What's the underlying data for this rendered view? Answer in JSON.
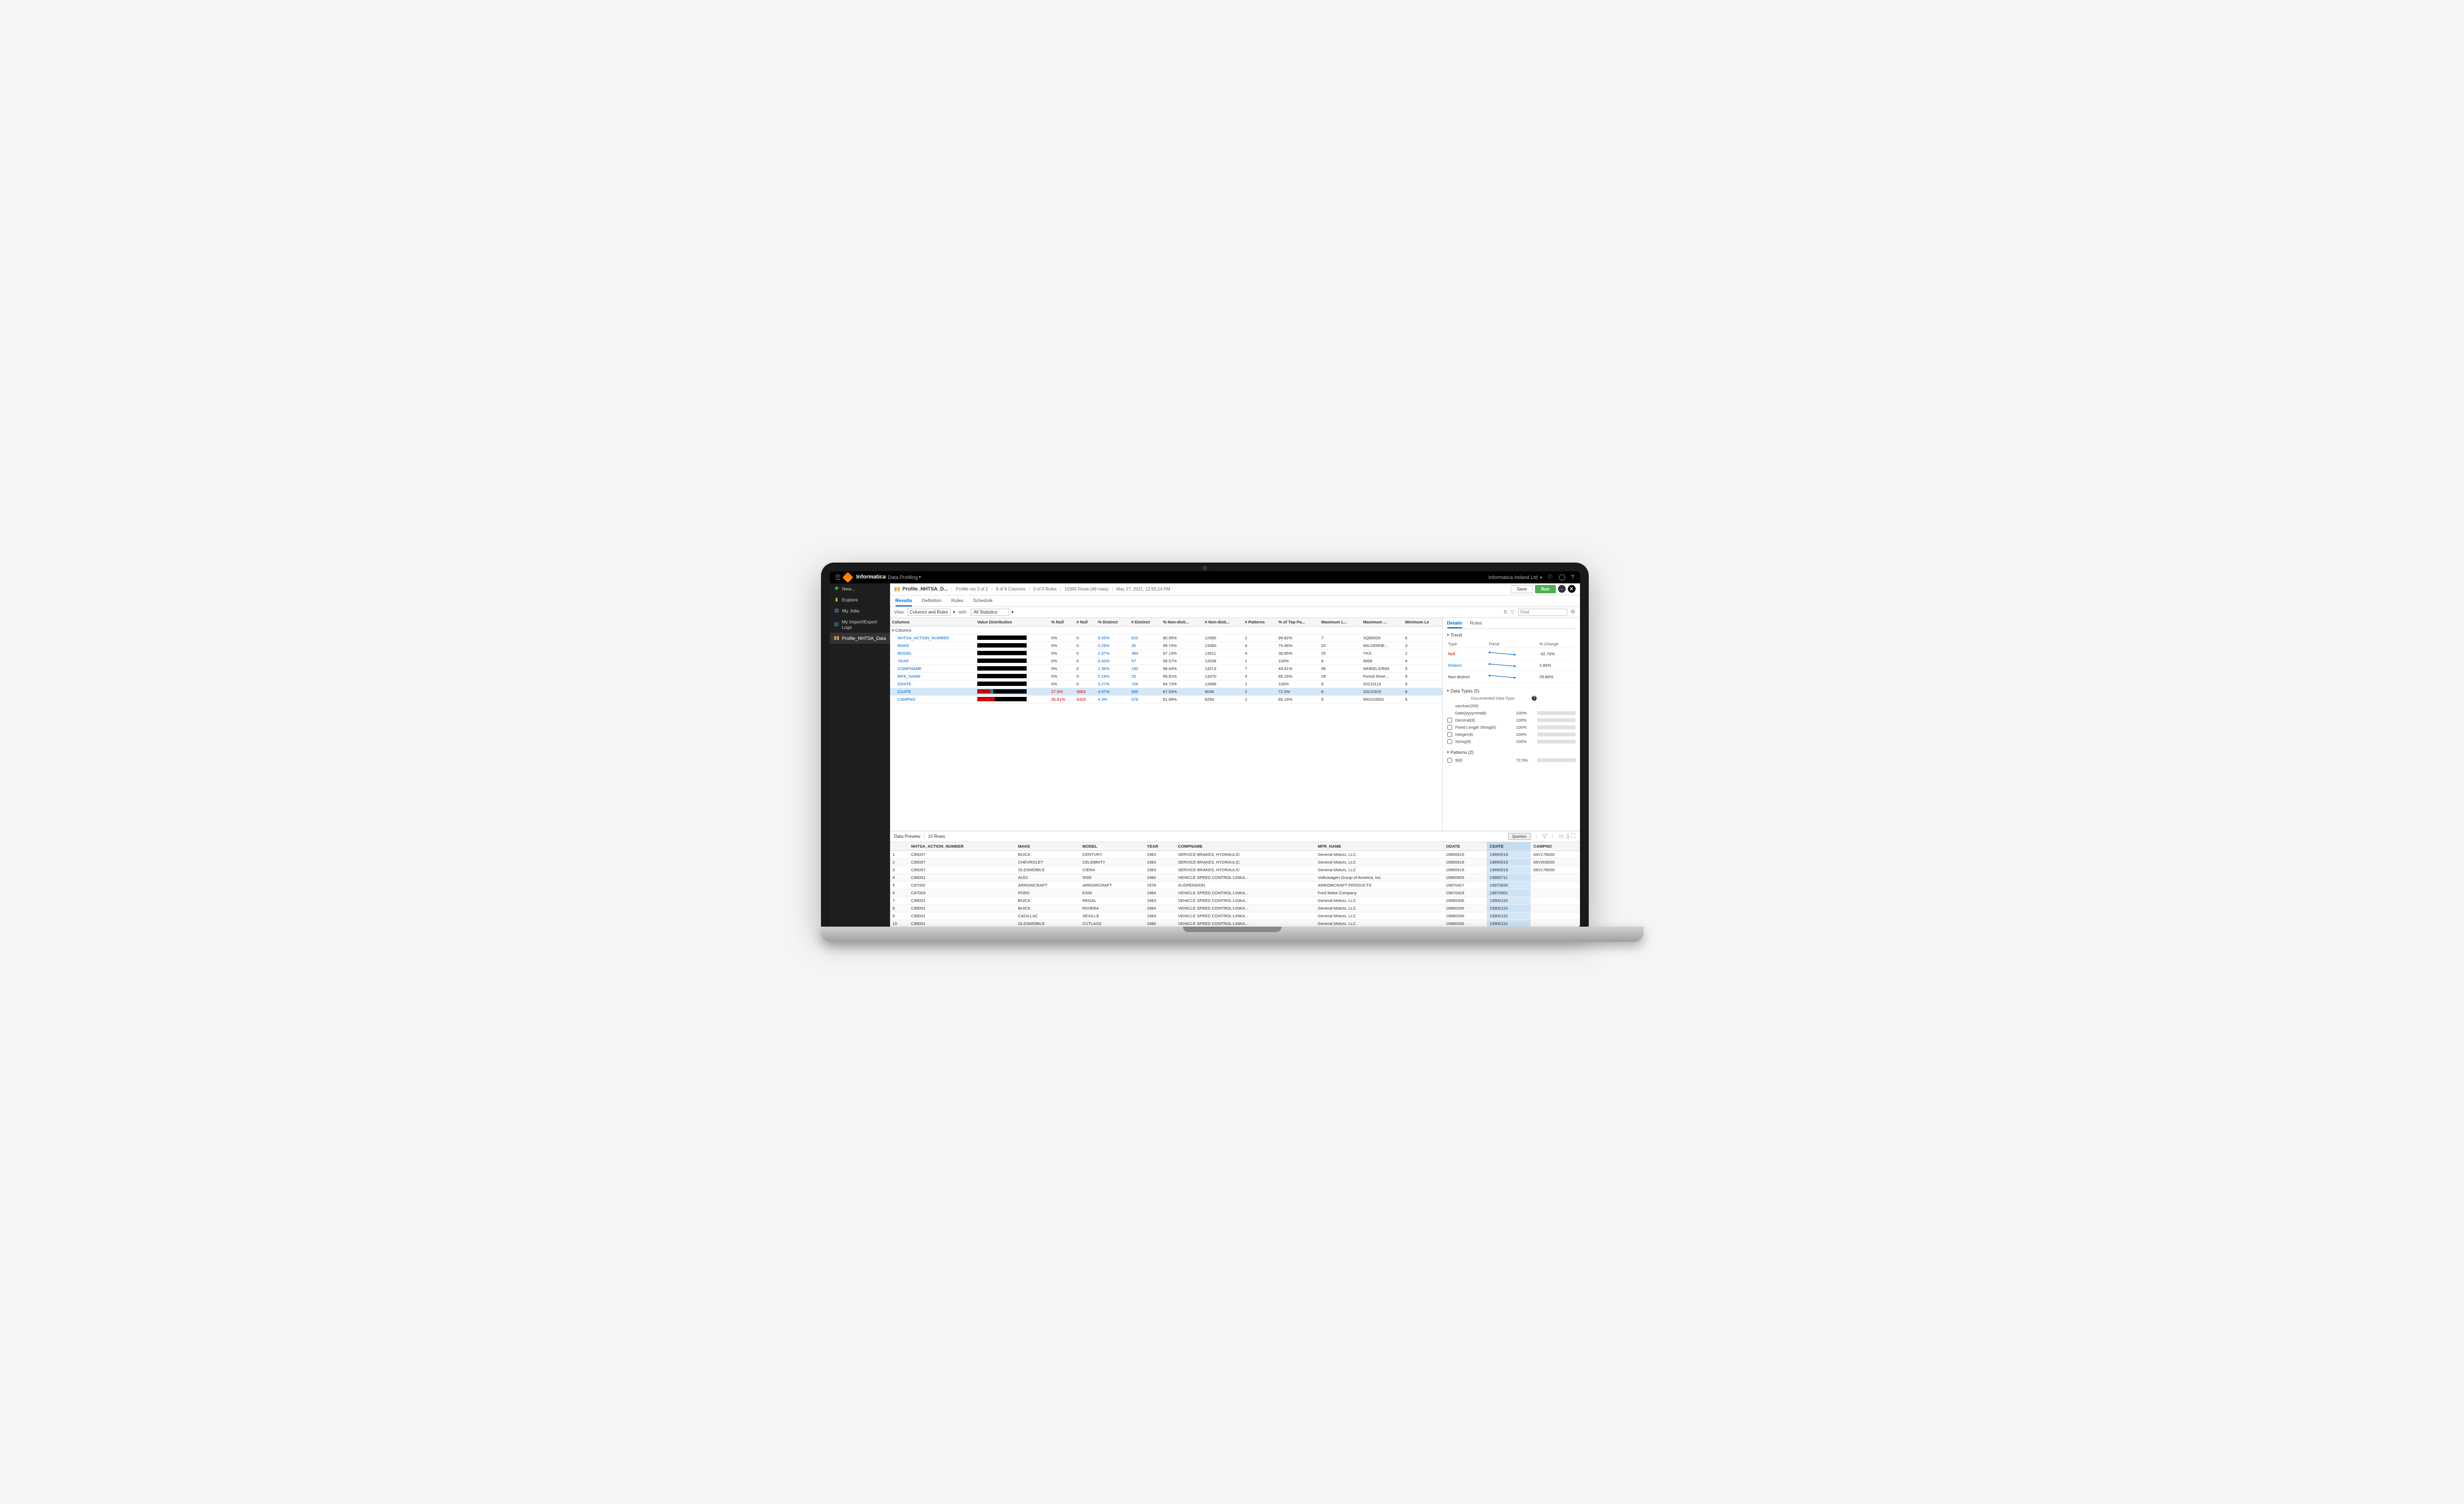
{
  "topbar": {
    "brand": "Informatica",
    "module": "Data Profiling",
    "org": "Informatica Ireland Ltd"
  },
  "sidebar": {
    "items": [
      {
        "icon": "ic-new",
        "label": "New..."
      },
      {
        "icon": "ic-explore",
        "label": "Explore"
      },
      {
        "icon": "ic-jobs",
        "label": "My Jobs"
      },
      {
        "icon": "ic-log",
        "label": "My Import/Export Logs"
      },
      {
        "icon": "ic-profile",
        "label": "Profile_NHTSA_Data",
        "active": true,
        "closable": true
      }
    ]
  },
  "tabheader": {
    "title": "Profile_NHTSA_D...",
    "info": [
      "Profile run 2 of 2",
      "9 of 9 Columns",
      "0 of 0 Rules",
      "10395 Rows (All rows)",
      "May 27, 2021, 12:55:14 PM"
    ],
    "save": "Save",
    "run": "Run"
  },
  "subtabs": [
    "Results",
    "Definition",
    "Rules",
    "Schedule"
  ],
  "viewbar": {
    "label": "View:",
    "select1": "Columns and Rules",
    "with": "with:",
    "select2": "All Statistics",
    "find": "Find"
  },
  "grid": {
    "headers": [
      "Columns",
      "Value Distribution",
      "% Null",
      "# Null",
      "% Distinct",
      "# Distinct",
      "% Non-disti...",
      "# Non-disti...",
      "# Patterns",
      "% of Top Pa...",
      "Maximum L...",
      "Maximum ...",
      "Minimum Le"
    ],
    "section": "Columns",
    "rows": [
      {
        "name": "NHTSA_ACTION_NUMBER",
        "d": {
          "r": 0,
          "t": 0
        },
        "pn": "0%",
        "nn": "0",
        "pd": "6.05%",
        "nd": "610",
        "pnd": "90.95%",
        "nnd": "12585",
        "pt": "2",
        "ptp": "99.82%",
        "ml": "7",
        "mx": "SQ99026",
        "mn": "6"
      },
      {
        "name": "MAKE",
        "d": {
          "r": 0,
          "t": 0
        },
        "pn": "0%",
        "nn": "0",
        "pd": "0.26%",
        "nd": "35",
        "pnd": "99.74%",
        "nnd": "13360",
        "pt": "4",
        "ptp": "75.46%",
        "ml": "20",
        "mx": "WILDERNE...",
        "mn": "3"
      },
      {
        "name": "MODEL",
        "d": {
          "r": 0,
          "t": 0
        },
        "pn": "0%",
        "nn": "0",
        "pd": "2.87%",
        "nd": "384",
        "pnd": "97.13%",
        "nnd": "13011",
        "pt": "4",
        "ptp": "36.85%",
        "ml": "25",
        "mx": "YKS",
        "mn": "2"
      },
      {
        "name": "YEAR",
        "d": {
          "r": 0,
          "t": 0
        },
        "pn": "0%",
        "nn": "0",
        "pd": "0.43%",
        "nd": "57",
        "pnd": "99.57%",
        "nnd": "13338",
        "pt": "1",
        "ptp": "100%",
        "ml": "4",
        "mx": "9999",
        "mn": "4"
      },
      {
        "name": "COMPNAME",
        "d": {
          "r": 0,
          "t": 0
        },
        "pn": "0%",
        "nn": "0",
        "pd": "1.36%",
        "nd": "182",
        "pnd": "98.64%",
        "nnd": "13213",
        "pt": "7",
        "ptp": "49.91%",
        "ml": "96",
        "mx": "WHEELS/RIM",
        "mn": "5"
      },
      {
        "name": "MFR_NAME",
        "d": {
          "r": 0,
          "t": 0
        },
        "pn": "0%",
        "nn": "0",
        "pd": "0.19%",
        "nd": "25",
        "pnd": "99.81%",
        "nnd": "13370",
        "pt": "4",
        "ptp": "85.25%",
        "ml": "28",
        "mx": "Forest River...",
        "mn": "9"
      },
      {
        "name": "ODATE",
        "d": {
          "r": 0,
          "t": 0
        },
        "pn": "0%",
        "nn": "0",
        "pd": "5.27%",
        "nd": "706",
        "pnd": "94.73%",
        "nnd": "12689",
        "pt": "1",
        "ptp": "100%",
        "ml": "8",
        "mx": "20210115",
        "mn": "8"
      },
      {
        "name": "CDATE",
        "sel": true,
        "d": {
          "r": 27.5,
          "t": 5
        },
        "pn": "27.5%",
        "nn": "3683",
        "pd": "4.97%",
        "nd": "666",
        "pnd": "67.53%",
        "nnd": "9046",
        "pt": "2",
        "ptp": "72.5%",
        "ml": "8",
        "mx": "20210915",
        "mn": "8",
        "red": true
      },
      {
        "name": "CAMPNO",
        "d": {
          "r": 36,
          "t": 0
        },
        "pn": "35.81%",
        "nn": "4329",
        "pd": "4.3%",
        "nd": "576",
        "pnd": "61.89%",
        "nnd": "8290",
        "pt": "2",
        "ptp": "66.19%",
        "ml": "9",
        "mx": "99V310002",
        "mn": "8",
        "red": true
      }
    ]
  },
  "details": {
    "tabs": [
      "Details",
      "Rules"
    ],
    "trend_hdr": "Trend",
    "trend_cols": [
      "Type",
      "Trend",
      "% Change"
    ],
    "trend_rows": [
      {
        "type": "Null",
        "cls": "trend-null",
        "change": "-32.75%"
      },
      {
        "type": "Distinct",
        "cls": "trend-dist",
        "change": "2.89%"
      },
      {
        "type": "Non-distinct",
        "cls": "",
        "change": "29.86%"
      }
    ],
    "dt_hdr": "Data Types (5)",
    "dt_doc": "Documented Data Type:",
    "dt_rows": [
      {
        "name": "varchar(255)",
        "pct": "",
        "nobar": true,
        "nocheck": true
      },
      {
        "name": "Date(yyyymmdd)",
        "pct": "100%",
        "nocheck": true
      },
      {
        "name": "Decimal(8)",
        "pct": "100%"
      },
      {
        "name": "Fixed Length String(8)",
        "pct": "100%"
      },
      {
        "name": "Integer(8)",
        "pct": "100%"
      },
      {
        "name": "String(8)",
        "pct": "100%"
      }
    ],
    "pat_hdr": "Patterns (2)",
    "pat_rows": [
      {
        "name": "9(8)",
        "pct": "72.5%",
        "fill": 72
      }
    ]
  },
  "preview": {
    "title": "Data Preview",
    "rows_label": "10 Rows",
    "queries": "Queries",
    "headers": [
      "",
      "NHTSA_ACTION_NUMBER",
      "MAKE",
      "MODEL",
      "YEAR",
      "COMPNAME",
      "MFR_NAME",
      "ODATE",
      "CDATE",
      "CAMPNO"
    ],
    "hl_col": 8,
    "data": [
      [
        "1",
        "C85007",
        "BUICK",
        "CENTURY",
        "1983",
        "SERVICE BRAKES, HYDRAULIC",
        "General Motors, LLC",
        "19850619",
        "19890518",
        "64V178000"
      ],
      [
        "2",
        "C85007",
        "CHEVROLET",
        "CELEBRITY",
        "1983",
        "SERVICE BRAKES, HYDRAULIC",
        "General Motors, LLC",
        "19850619",
        "19890518",
        "66V003000"
      ],
      [
        "3",
        "C85007",
        "OLDSMOBILE",
        "CIERA",
        "1983",
        "SERVICE BRAKES, HYDRAULIC",
        "General Motors, LLC",
        "19850619",
        "19890518",
        "66V178000"
      ],
      [
        "4",
        "C86001",
        "AUDI",
        "5000",
        "1980",
        "VEHICLE SPEED CONTROL:LINKA...",
        "Volkswagen Group of America, Inc.",
        "19860805",
        "19890711",
        ""
      ],
      [
        "5",
        "C87002",
        "ARROWCRAFT",
        "ARROWCRAFT",
        "1978",
        "SUSPENSION",
        "ARROWCRAFT PRODUCTS",
        "19870427",
        "19970830",
        ""
      ],
      [
        "6",
        "C87003",
        "FORD",
        "E350",
        "1984",
        "VEHICLE SPEED CONTROL:LINKA...",
        "Ford Motor Company",
        "19870429",
        "19870901",
        ""
      ],
      [
        "7",
        "C89001",
        "BUICK",
        "REGAL",
        "1983",
        "VEHICLE SPEED CONTROL:LINKA...",
        "General Motors, LLC",
        "19890306",
        "19900116",
        ""
      ],
      [
        "8",
        "C89001",
        "BUICK",
        "RIVIERA",
        "1984",
        "VEHICLE SPEED CONTROL:LINKA...",
        "General Motors, LLC",
        "19890306",
        "19900116",
        ""
      ],
      [
        "9",
        "C89001",
        "CADILLAC",
        "SEVILLE",
        "1983",
        "VEHICLE SPEED CONTROL:LINKA...",
        "General Motors, LLC",
        "19890306",
        "19900116",
        ""
      ],
      [
        "10",
        "C89001",
        "OLDSMOBILE",
        "CUTLASS",
        "1986",
        "VEHICLE SPEED CONTROL:LINKA...",
        "General Motors, LLC",
        "19890306",
        "19900116",
        ""
      ]
    ]
  }
}
